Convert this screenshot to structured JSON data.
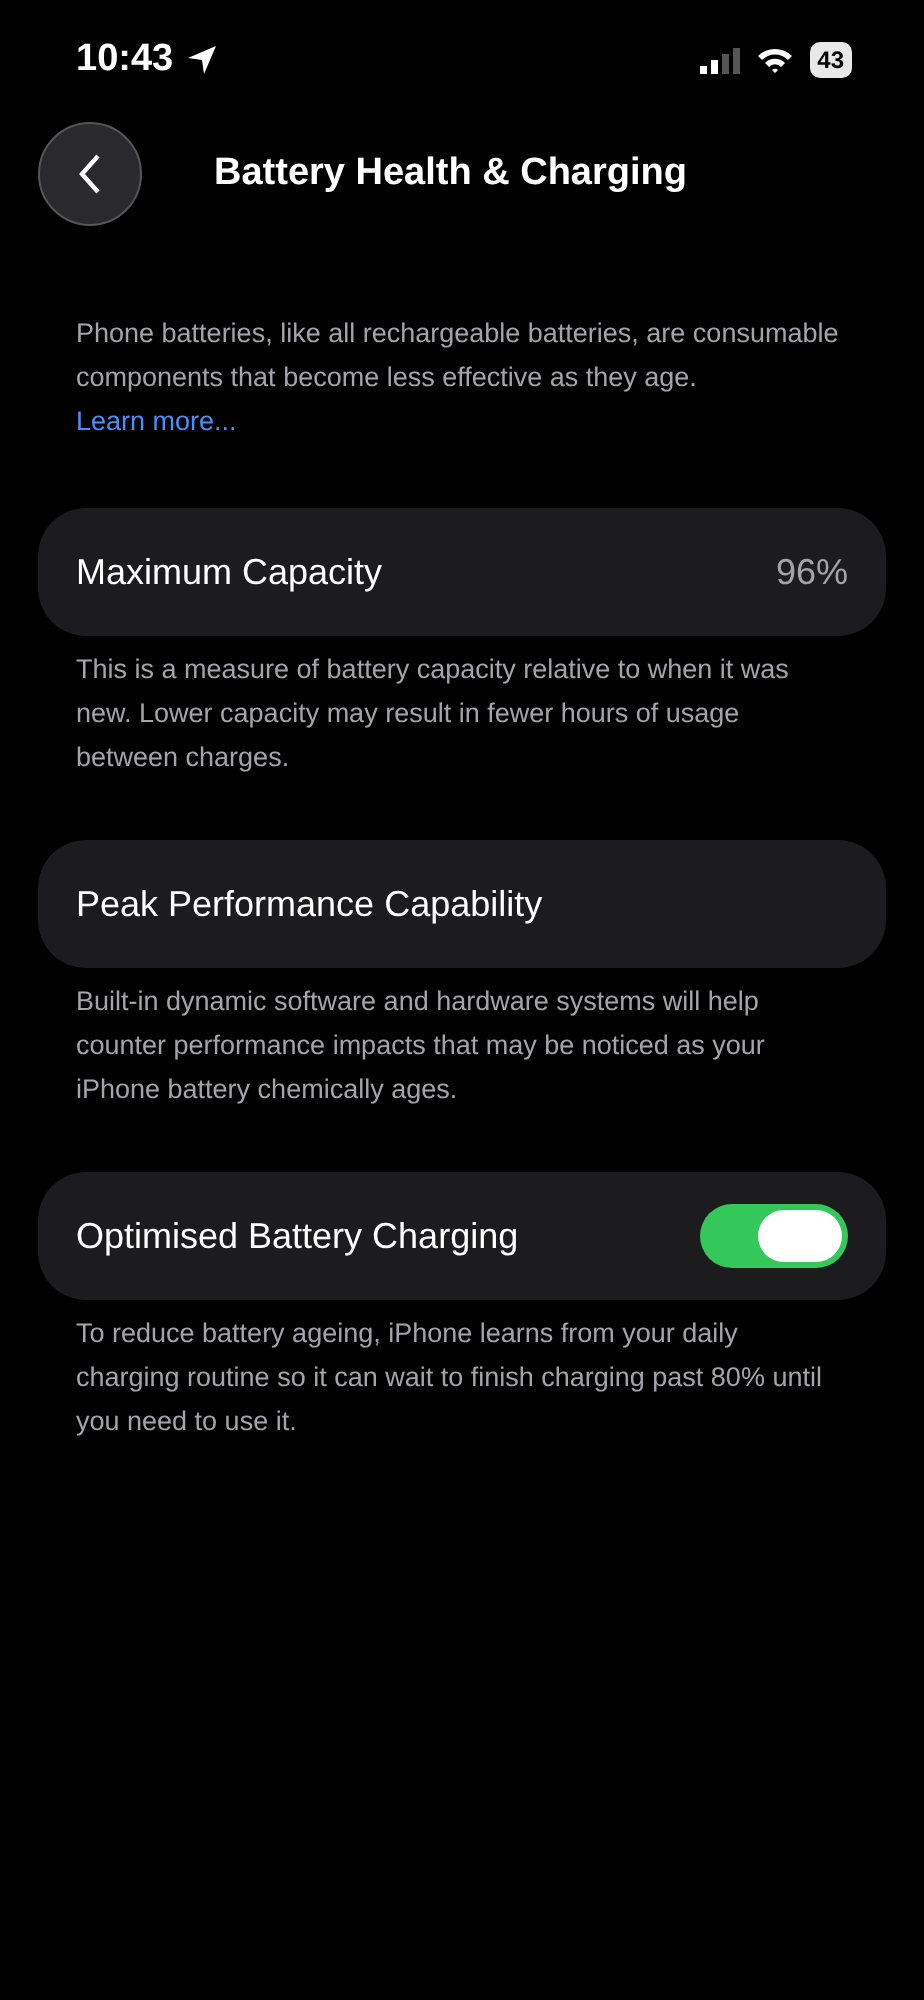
{
  "status_bar": {
    "time": "10:43",
    "battery": "43"
  },
  "header": {
    "title": "Battery Health & Charging"
  },
  "intro": {
    "text": "Phone batteries, like all rechargeable batteries, are consumable components that become less effective as they age.",
    "link": "Learn more..."
  },
  "sections": [
    {
      "kind": "value",
      "label": "Maximum Capacity",
      "value": "96%",
      "footer": "This is a measure of battery capacity relative to when it was new. Lower capacity may result in fewer hours of usage between charges."
    },
    {
      "kind": "plain",
      "label": "Peak Performance Capability",
      "footer": "Built-in dynamic software and hardware systems will help counter performance impacts that may be noticed as your iPhone battery chemically ages."
    },
    {
      "kind": "toggle",
      "label": "Optimised Battery Charging",
      "on": true,
      "footer": "To reduce battery ageing, iPhone learns from your daily charging routine so it can wait to finish charging past 80% until you need to use it."
    }
  ]
}
